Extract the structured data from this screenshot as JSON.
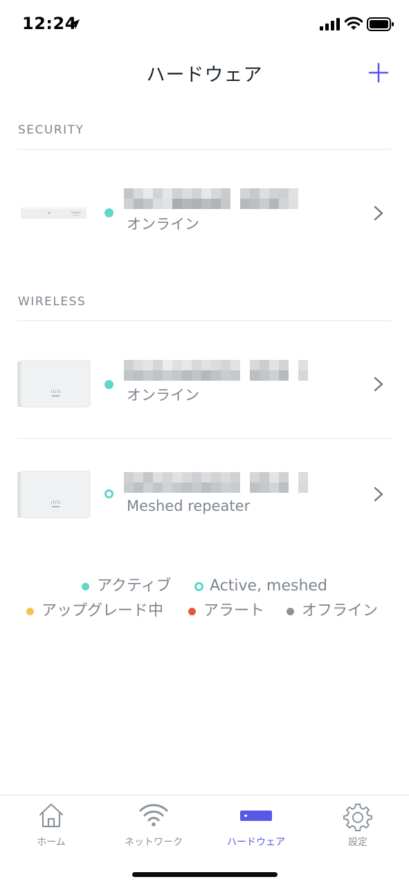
{
  "status_bar": {
    "time": "12:24"
  },
  "nav": {
    "title": "ハードウェア",
    "add_icon": "plus-icon"
  },
  "colors": {
    "accent": "#5a57e6",
    "active": "#5fd6c8",
    "upgrading": "#f2c452",
    "alert": "#e5573b",
    "offline": "#8c939b"
  },
  "sections": [
    {
      "header": "SECURITY",
      "devices": [
        {
          "image": "security-appliance-image",
          "status_dot": "active",
          "status": "オンライン"
        }
      ]
    },
    {
      "header": "WIRELESS",
      "devices": [
        {
          "image": "access-point-image",
          "status_dot": "active",
          "status": "オンライン"
        },
        {
          "image": "access-point-image",
          "status_dot": "active-meshed",
          "status": "Meshed repeater"
        }
      ]
    }
  ],
  "legend": {
    "active": "アクティブ",
    "active_meshed": "Active, meshed",
    "upgrading": "アップグレード中",
    "alert": "アラート",
    "offline": "オフライン"
  },
  "tabs": [
    {
      "label": "ホーム",
      "icon": "home-icon",
      "active": false
    },
    {
      "label": "ネットワーク",
      "icon": "wifi-icon",
      "active": false
    },
    {
      "label": "ハードウェア",
      "icon": "hardware-icon",
      "active": true
    },
    {
      "label": "設定",
      "icon": "gear-icon",
      "active": false
    }
  ]
}
